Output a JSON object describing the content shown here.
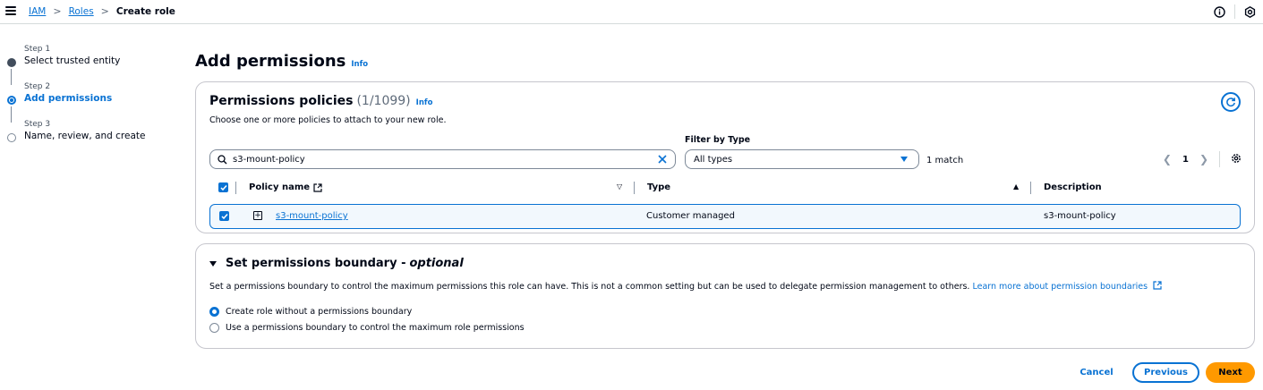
{
  "breadcrumb": {
    "items": [
      "IAM",
      "Roles"
    ],
    "separator": ">",
    "current": "Create role"
  },
  "steps": [
    {
      "number": "Step 1",
      "title": "Select trusted entity",
      "state": "done"
    },
    {
      "number": "Step 2",
      "title": "Add permissions",
      "state": "active"
    },
    {
      "number": "Step 3",
      "title": "Name, review, and create",
      "state": "todo"
    }
  ],
  "page": {
    "title": "Add permissions",
    "info": "Info"
  },
  "policies": {
    "title": "Permissions policies",
    "count": "(1/1099)",
    "info": "Info",
    "description": "Choose one or more policies to attach to your new role.",
    "filter_label": "Filter by Type",
    "search_value": "s3-mount-policy",
    "filter_value": "All types",
    "match_count": "1 match",
    "page_number": "1",
    "columns": {
      "name": "Policy name",
      "type": "Type",
      "description": "Description"
    },
    "rows": [
      {
        "name": "s3-mount-policy",
        "type": "Customer managed",
        "description": "s3-mount-policy",
        "selected": true
      }
    ]
  },
  "boundary": {
    "title": "Set permissions boundary - ",
    "optional": "optional",
    "description": "Set a permissions boundary to control the maximum permissions this role can have. This is not a common setting but can be used to delegate permission management to others. ",
    "learn_more": "Learn more about permission boundaries",
    "options": [
      {
        "label": "Create role without a permissions boundary",
        "selected": true
      },
      {
        "label": "Use a permissions boundary to control the maximum role permissions",
        "selected": false
      }
    ]
  },
  "footer": {
    "cancel": "Cancel",
    "previous": "Previous",
    "next": "Next"
  },
  "colors": {
    "primary": "#0972d3",
    "accent": "#ff9900",
    "text": "#000716"
  }
}
